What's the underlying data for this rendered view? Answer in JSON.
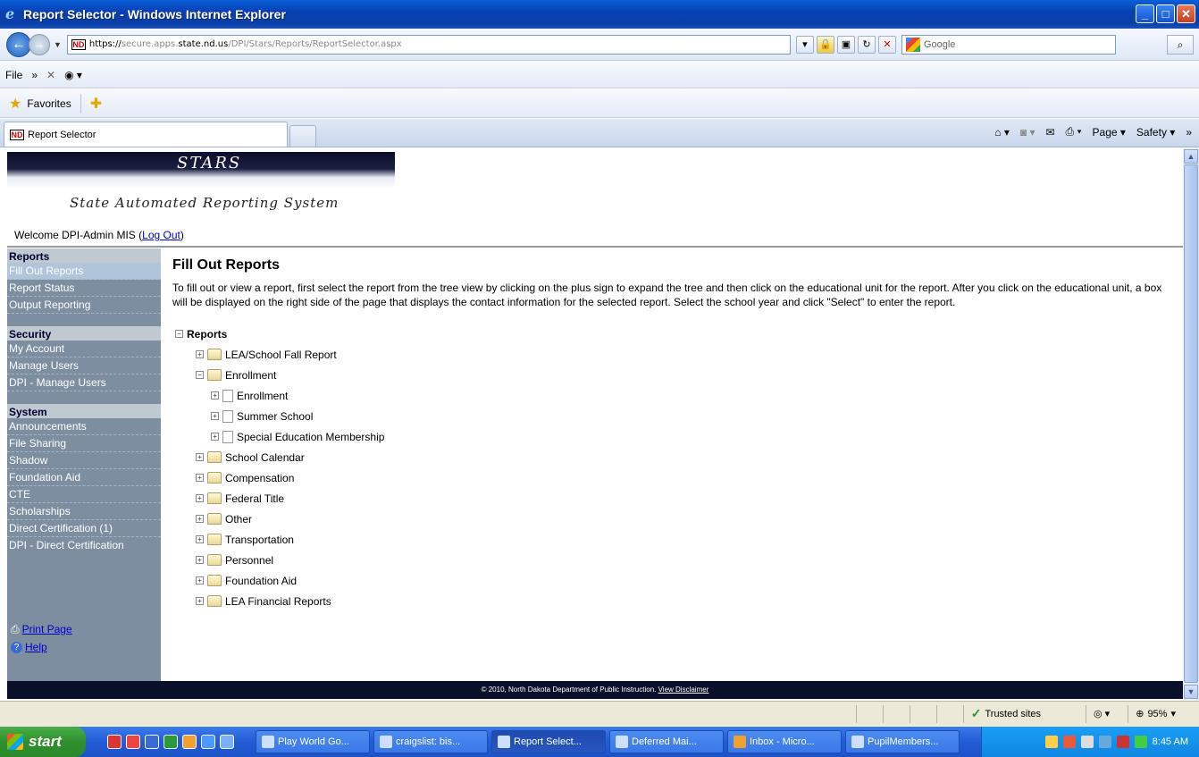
{
  "window": {
    "title": "Report Selector - Windows Internet Explorer"
  },
  "address": {
    "url_prefix": "https://",
    "url_gray1": "secure.apps.",
    "url_dark": "state.nd.us",
    "url_gray2": "/DPI/Stars/Reports/ReportSelector.aspx",
    "search_placeholder": "Google"
  },
  "menubar": {
    "file": "File",
    "more": "»"
  },
  "favbar": {
    "favorites": "Favorites"
  },
  "tab": {
    "label": "Report Selector"
  },
  "cmdbar": {
    "page": "Page ▾",
    "safety": "Safety ▾",
    "more": "»"
  },
  "banner": {
    "title": "STARS",
    "subtitle": "State Automated Reporting System"
  },
  "welcome": {
    "text": "Welcome DPI-Admin MIS (",
    "logout": "Log Out",
    "close": ")"
  },
  "sidebar": {
    "sections": [
      {
        "header": "Reports",
        "items": [
          "Fill Out Reports",
          "Report Status",
          "Output Reporting"
        ]
      },
      {
        "header": "Security",
        "items": [
          "My Account",
          "Manage Users",
          "DPI - Manage Users"
        ]
      },
      {
        "header": "System",
        "items": [
          "Announcements",
          "File Sharing",
          "Shadow",
          "Foundation Aid",
          "CTE",
          "Scholarships",
          "Direct Certification (1)",
          "DPI - Direct Certification"
        ]
      }
    ],
    "print_page": "Print Page",
    "help": "Help"
  },
  "main": {
    "title": "Fill Out Reports",
    "instructions": "To fill out or view a report, first select the report from the tree view by clicking on the plus sign to expand the tree and then click on the educational unit for the report. After you click on the educational unit, a box will be displayed on the right side of the page that displays the contact information for the selected report. Select the school year and click \"Select\" to enter the report."
  },
  "tree": {
    "root": "Reports",
    "nodes": [
      {
        "label": "LEA/School Fall Report",
        "level": 1,
        "type": "folder"
      },
      {
        "label": "Enrollment",
        "level": 1,
        "type": "folder",
        "expanded": true
      },
      {
        "label": "Enrollment",
        "level": 2,
        "type": "doc"
      },
      {
        "label": "Summer School",
        "level": 2,
        "type": "doc"
      },
      {
        "label": "Special Education Membership",
        "level": 2,
        "type": "doc"
      },
      {
        "label": "School Calendar",
        "level": 1,
        "type": "folder"
      },
      {
        "label": "Compensation",
        "level": 1,
        "type": "folder"
      },
      {
        "label": "Federal Title",
        "level": 1,
        "type": "folder"
      },
      {
        "label": "Other",
        "level": 1,
        "type": "folder"
      },
      {
        "label": "Transportation",
        "level": 1,
        "type": "folder"
      },
      {
        "label": "Personnel",
        "level": 1,
        "type": "folder"
      },
      {
        "label": "Foundation Aid",
        "level": 1,
        "type": "folder"
      },
      {
        "label": "LEA Financial Reports",
        "level": 1,
        "type": "folder"
      }
    ]
  },
  "footer": {
    "text": "© 2010, North Dakota Department of Public Instruction. ",
    "disclaimer": "View Disclaimer"
  },
  "statusbar": {
    "zone": "Trusted sites",
    "zoom": "95%"
  },
  "taskbar": {
    "start": "start",
    "buttons": [
      "Play World Go...",
      "craigslist: bis...",
      "Report Select...",
      "Deferred Mai...",
      "Inbox - Micro...",
      "PupilMembers..."
    ],
    "active_index": 2,
    "clock": "8:45 AM"
  },
  "colors": {
    "sidebar_bg": "#7c8ea0",
    "titlebar": "#0a5fd8",
    "footer_bg": "#0a0f2a",
    "taskbar": "#245ed8"
  }
}
